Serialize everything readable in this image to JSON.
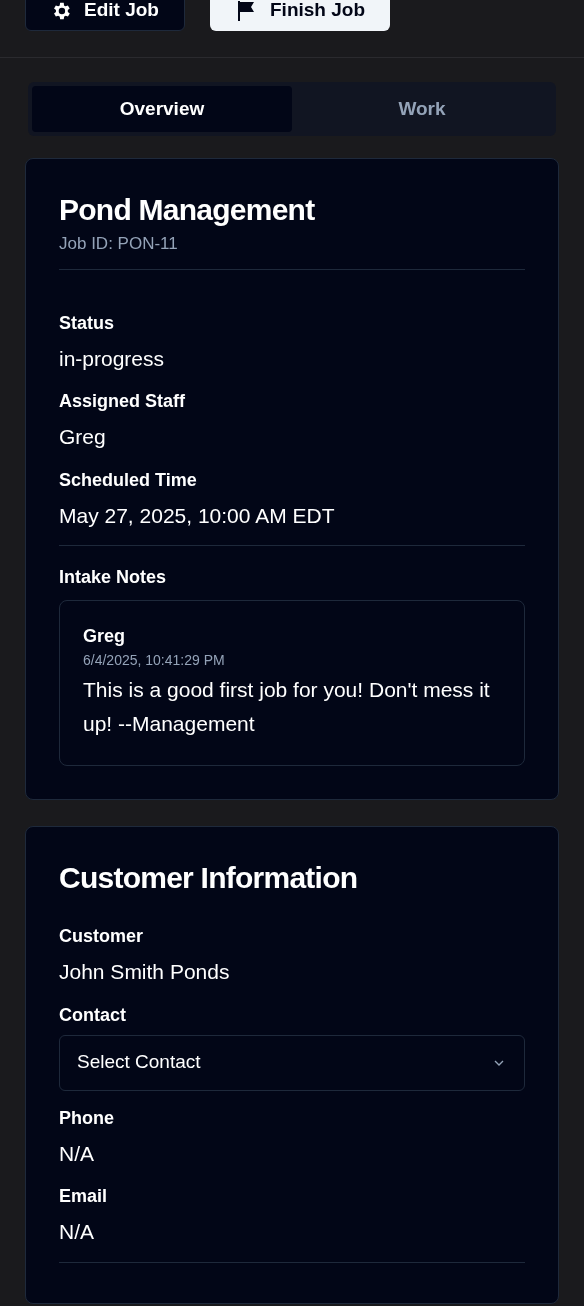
{
  "header_buttons": [
    {
      "kind": "gear",
      "label": "Edit Job",
      "primary": false
    },
    {
      "kind": "flag",
      "label": "Finish Job",
      "primary": true
    }
  ],
  "tabs": [
    {
      "label": "Overview",
      "selected": true
    },
    {
      "label": "Work",
      "selected": false
    }
  ],
  "job": {
    "title": "Pond Management",
    "job_id": "Job ID: PON-11",
    "fields": [
      {
        "label": "Status",
        "value": "in-progress"
      },
      {
        "label": "Assigned Staff",
        "value": "Greg"
      },
      {
        "label": "Scheduled Time",
        "value": "May 27, 2025, 10:00 AM EDT"
      }
    ],
    "notes_label": "Intake Notes",
    "notes": [
      {
        "author": "Greg",
        "time": "6/4/2025, 10:41:29 PM",
        "text": "This is a good first job for you! Don't mess it up! --Management"
      }
    ]
  },
  "customer": {
    "title": "Customer Information",
    "fields": [
      {
        "kind": "text",
        "label": "Customer",
        "value": "John Smith Ponds"
      },
      {
        "kind": "select",
        "label": "Contact",
        "value": "Select Contact"
      },
      {
        "kind": "text",
        "label": "Phone",
        "value": "N/A"
      },
      {
        "kind": "text",
        "label": "Email",
        "value": "N/A"
      }
    ]
  }
}
